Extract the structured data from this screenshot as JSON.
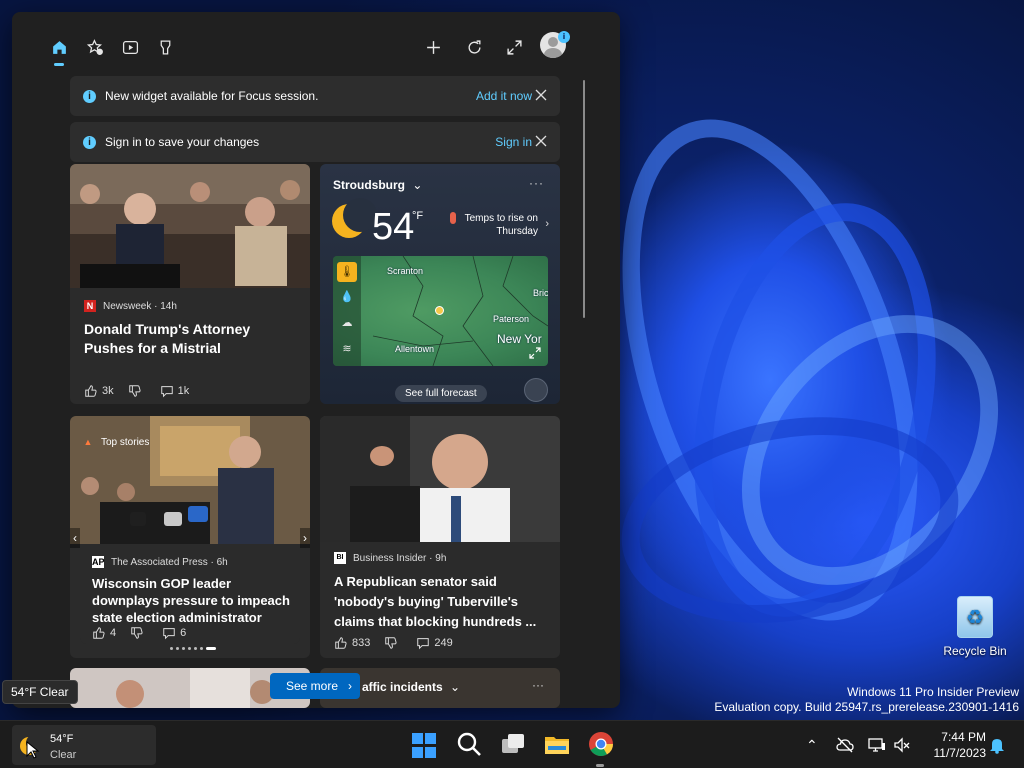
{
  "panel": {
    "banner_focus": {
      "message": "New widget available for Focus session.",
      "action": "Add it now"
    },
    "banner_signin": {
      "message": "Sign in to save your changes",
      "action": "Sign in"
    },
    "card_trump": {
      "source": "Newsweek · 14h",
      "headline": "Donald Trump's Attorney Pushes for a Mistrial",
      "likes": "3k",
      "comments": "1k"
    },
    "weather": {
      "location": "Stroudsburg",
      "temp": "54",
      "unit": "°F",
      "note": "Temps to rise on Thursday",
      "map_labels": [
        "Scranton",
        "Bric",
        "Paterson",
        "New Yor",
        "Allentown"
      ],
      "forecast_button": "See full forecast"
    },
    "card_gop": {
      "tag": "Top stories",
      "source": "The Associated Press · 6h",
      "headline": "Wisconsin GOP leader downplays pressure to impeach state election administrator",
      "likes": "4",
      "comments": "6"
    },
    "card_senator": {
      "source": "Business Insider · 9h",
      "headline": "A Republican senator said 'nobody's buying' Tuberville's claims that blocking hundreds ...",
      "likes": "833",
      "comments": "249"
    },
    "traffic": {
      "label": "affic incidents"
    },
    "see_more": "See more"
  },
  "tooltip": "54°F Clear",
  "desktop": {
    "recycle_bin": "Recycle Bin",
    "watermark_line1": "Windows 11 Pro Insider Preview",
    "watermark_line2": "Evaluation copy. Build 25947.rs_prerelease.230901-1416"
  },
  "taskbar": {
    "weather_temp": "54°F",
    "weather_cond": "Clear",
    "time": "7:44 PM",
    "date": "11/7/2023"
  },
  "colors": {
    "accent": "#60cdff",
    "button": "#0067c0",
    "moon": "#f5b31f"
  }
}
